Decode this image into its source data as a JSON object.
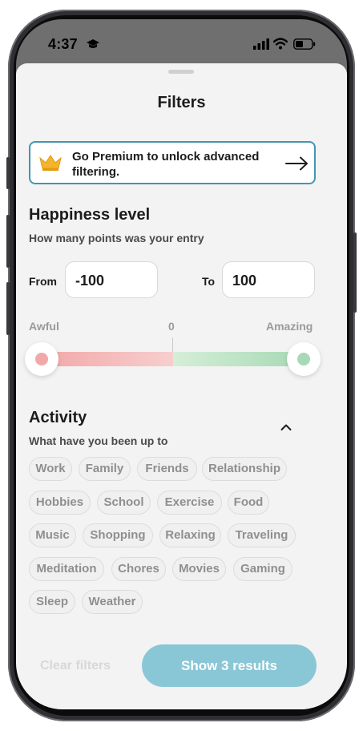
{
  "status_bar": {
    "time": "4:37"
  },
  "sheet": {
    "title": "Filters"
  },
  "premium_banner": {
    "text": "Go Premium to unlock advanced filtering."
  },
  "happiness": {
    "title": "Happiness level",
    "subtitle": "How many points was your entry",
    "from_label": "From",
    "from_value": "-100",
    "to_label": "To",
    "to_value": "100",
    "scale_min_label": "Awful",
    "scale_mid_label": "0",
    "scale_max_label": "Amazing"
  },
  "activity": {
    "title": "Activity",
    "subtitle": "What have you been up to",
    "tags": [
      "Work",
      "Family",
      "Friends",
      "Relationship",
      "Hobbies",
      "School",
      "Exercise",
      "Food",
      "Music",
      "Shopping",
      "Relaxing",
      "Traveling",
      "Meditation",
      "Chores",
      "Movies",
      "Gaming",
      "Sleep",
      "Weather"
    ]
  },
  "footer": {
    "clear_label": "Clear filters",
    "show_label": "Show 3 results"
  },
  "colors": {
    "accent_border": "#3f97b4",
    "primary_button": "#8ac7d6",
    "negative": "#f2a8a8",
    "positive": "#a6d9b4"
  }
}
